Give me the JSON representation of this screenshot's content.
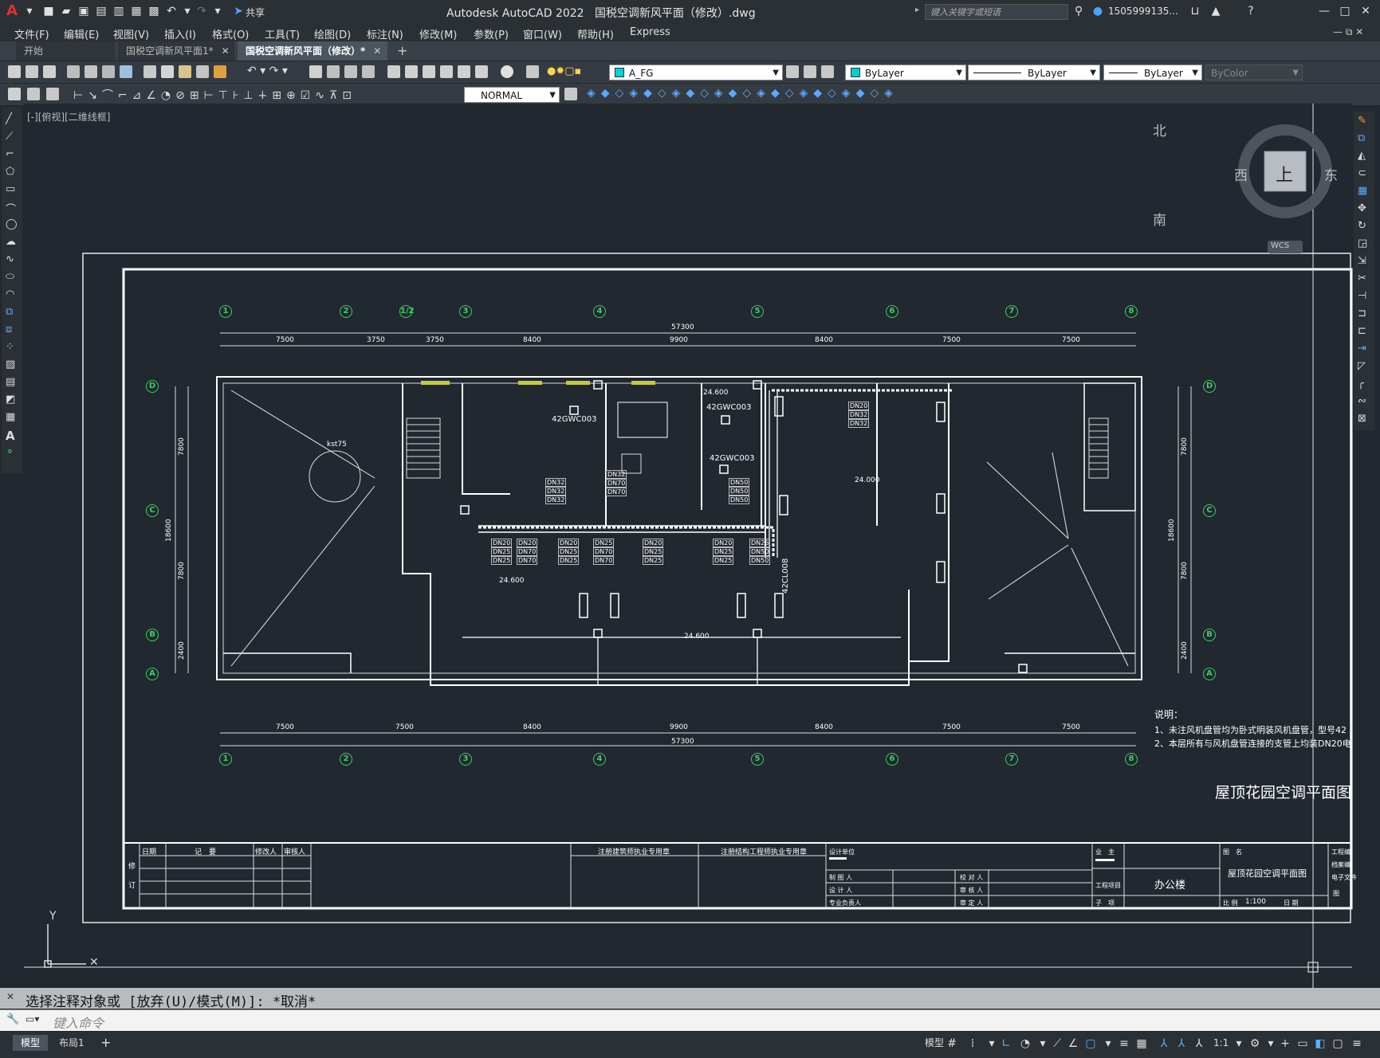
{
  "app": {
    "title": "Autodesk AutoCAD 2022",
    "document": "国税空调新风平面（修改）.dwg",
    "share_label": "共享",
    "search_placeholder": "键入关键字或短语",
    "user": "1505999135...",
    "logo_letter": "A"
  },
  "menu": [
    "文件(F)",
    "编辑(E)",
    "视图(V)",
    "插入(I)",
    "格式(O)",
    "工具(T)",
    "绘图(D)",
    "标注(N)",
    "修改(M)",
    "参数(P)",
    "窗口(W)",
    "帮助(H)",
    "Express"
  ],
  "tabs": [
    {
      "label": "开始",
      "active": false
    },
    {
      "label": "国税空调新风平面1*",
      "active": false
    },
    {
      "label": "国税空调新风平面（修改）*",
      "active": true
    }
  ],
  "toolbar": {
    "layer": "A_FG",
    "color": "ByLayer",
    "linetype": "ByLayer",
    "lineweight": "ByLayer",
    "plotstyle": "ByColor",
    "dimstyle": "NORMAL"
  },
  "viewport_label": "[-][俯视][二维线框]",
  "viewcube": {
    "north": "北",
    "south": "南",
    "east": "东",
    "west": "西",
    "top": "上",
    "wcs": "WCS"
  },
  "drawing": {
    "grid_top": [
      "1",
      "2",
      "1/2",
      "3",
      "4",
      "5",
      "6",
      "7",
      "8"
    ],
    "grid_bottom": [
      "1",
      "2",
      "3",
      "4",
      "5",
      "6",
      "7",
      "8"
    ],
    "grid_side": [
      "D",
      "C",
      "B",
      "A"
    ],
    "dims_top": [
      "7500",
      "3750",
      "3750",
      "8400",
      "9900",
      "8400",
      "7500",
      "7500"
    ],
    "dims_bottom": [
      "7500",
      "7500",
      "8400",
      "9900",
      "8400",
      "7500",
      "7500"
    ],
    "total_length": "57300",
    "side_dims": [
      "7800",
      "7800",
      "2400"
    ],
    "side_total": "18600",
    "elevations": [
      "24.600",
      "24.600",
      "24.600",
      "24.000"
    ],
    "labels": [
      "42GWC003",
      "42GWC003",
      "42CL008",
      "kst75"
    ],
    "pipes": [
      "DN20",
      "DN25",
      "DN32",
      "DN50",
      "DN70"
    ],
    "notes_title": "说明：",
    "notes": [
      "1、未注风机盘管均为卧式明装风机盘管，型号42",
      "2、本层所有与风机盘管连接的支管上均装DN20电"
    ],
    "drawing_title": "屋顶花园空调平面图",
    "titleblock": {
      "date": "日期",
      "record": "记　要",
      "modifier": "修改人",
      "reviewer": "审核人",
      "revise": "修",
      "order": "订",
      "arch_seal": "注册建筑师执业专用章",
      "struct_seal": "注册结构工程师执业专用章",
      "design_unit": "设计单位",
      "drawn_by": "制 图 人",
      "designer": "设 计 人",
      "lead": "专业负责人",
      "checker": "校 对 人",
      "auditor": "审 核 人",
      "approver": "审 定 人",
      "owner": "业　主",
      "project": "工程项目",
      "subitem": "子　项",
      "building": "办公楼",
      "title_label": "图　名",
      "sheet_title": "屋顶花园空调平面图",
      "scale_label": "比 例",
      "scale": "1:100",
      "date_label": "日 期",
      "job_no": "工程编",
      "file_no": "档案编",
      "e_file": "电子文件",
      "fig": "图"
    }
  },
  "command": {
    "history": "选择注释对象或 [放弃(U)/模式(M)]: *取消*",
    "placeholder": "键入命令"
  },
  "status": {
    "tabs": [
      "模型",
      "布局1"
    ],
    "model_button": "模型",
    "scale": "1:1"
  }
}
